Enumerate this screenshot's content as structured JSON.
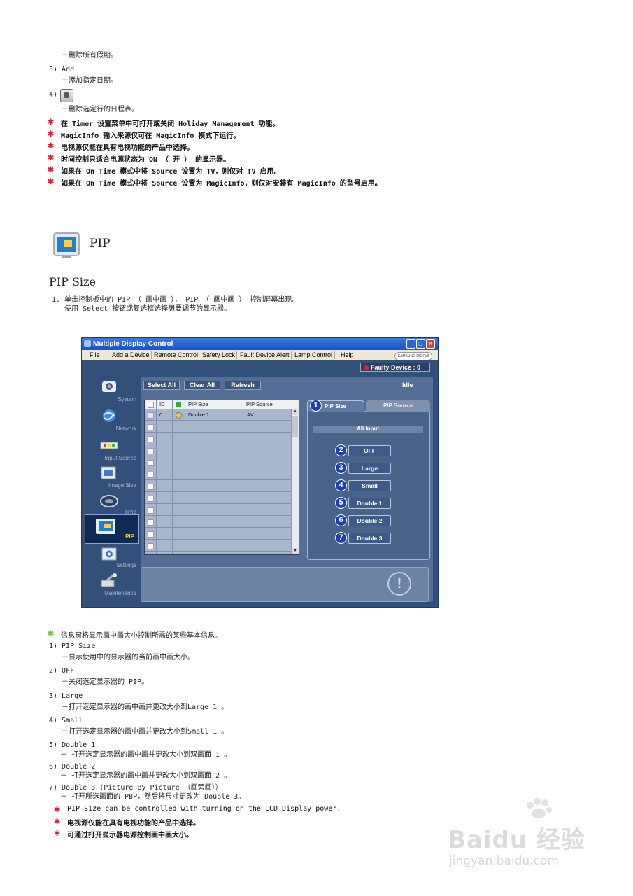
{
  "top_section": {
    "l1": "－删除所有假期。",
    "l2": "3) Add",
    "l3": "－添加指定日期。",
    "l4": "4)",
    "l5": "－删除选定行的日程表。"
  },
  "notes1": [
    "在 Timer 设置菜单中可打开或关闭 Holiday Management 功能。",
    "MagicInfo 输入来源仅可在 MagicInfo 模式下运行。",
    "电视源仅能在具有电视功能的产品中选择。",
    "时间控制只适合电源状态为 ON （ 开 ） 的显示器。",
    "如果在 On Time 模式中将 Source 设置为 TV，则仅对 TV 启用。",
    "如果在 On Time 模式中将 Source 设置为 MagicInfo，则仅对安装有 MagicInfo 的型号启用。"
  ],
  "pip_heading": "PIP",
  "pip_size_heading": "PIP Size",
  "step1": "1. 单击控制板中的 PIP （ 画中画 ）， PIP （ 画中画 ） 控制屏幕出现。",
  "step1b": "使用 Select 按钮或复选框选择想要调节的显示器。",
  "app": {
    "title": "Multiple Display Control",
    "menu": [
      "File",
      "Add a Device",
      "Remote Control",
      "Safety Lock",
      "Fault Device Alert",
      "Lamp Control",
      "Help"
    ],
    "brand": "SAMSUNG DIGITall",
    "faulty": "Faulty Device : 0",
    "nav": [
      "System",
      "Network",
      "Input Source",
      "Image Size",
      "Time",
      "PIP",
      "Settings",
      "Maintenance"
    ],
    "toolbar": [
      "Select All",
      "Clear All",
      "Refresh"
    ],
    "status": "Idle",
    "columns": [
      "ID",
      "PIP Size",
      "PIP Source"
    ],
    "row1": {
      "id": "0",
      "size": "Double 1",
      "source": "AV"
    },
    "tabs": [
      "PIP Size",
      "PIP Source"
    ],
    "all_input": "All Input",
    "options": [
      "OFF",
      "Large",
      "Small",
      "Double 1",
      "Double 2",
      "Double 3"
    ],
    "numbers": [
      "1",
      "2",
      "3",
      "4",
      "5",
      "6",
      "7"
    ]
  },
  "info_intro": "信息窗格显示画中画大小控制所需的某些基本信息。",
  "items": [
    {
      "h": "1) PIP Size",
      "d": "－显示使用中的显示器的当前画中画大小。"
    },
    {
      "h": "2) OFF",
      "d": "－关闭选定显示器的 PIP。"
    },
    {
      "h": "3) Large",
      "d": "－打开选定显示器的画中画并更改大小到Large 1 。"
    },
    {
      "h": "4) Small",
      "d": "－打开选定显示器的画中画并更改大小到Small 1 。"
    },
    {
      "h": "5) Double 1",
      "d": "－ 打开选定显示器的画中画并更改大小到双画面 1 。"
    },
    {
      "h": "6) Double 2",
      "d": "－ 打开选定显示器的画中画并更改大小到双画面 2 。"
    },
    {
      "h": "7) Double 3 (Picture By Picture （画旁画））",
      "d": "－ 打开所选画面的 PBP，然后将尺寸更改为 Double 3。"
    }
  ],
  "notes2": [
    "PIP Size can be controlled with turning on the LCD Display power.",
    "电视源仅能在具有电视功能的产品中选择。",
    "可通过打开显示器电源控制画中画大小。"
  ],
  "watermark": {
    "logo": "Baidu 经验",
    "url": "jingyan.baidu.com"
  },
  "colors": {
    "star_red": "#e0182f",
    "star_green": "#7dc242",
    "app_bg": "#33507a"
  }
}
